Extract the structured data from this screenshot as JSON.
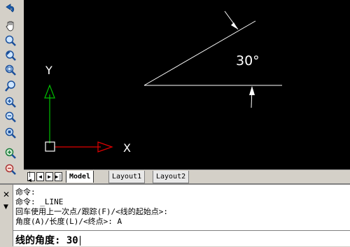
{
  "drawing": {
    "y_axis_label": "Y",
    "x_axis_label": "X",
    "angle_label": "30°"
  },
  "tabs": {
    "items": [
      "Model",
      "Layout1",
      "Layout2"
    ],
    "active": "Model"
  },
  "command": {
    "lines": [
      "命令:",
      "命令: _LINE",
      "回车使用上一次点/跟踪(F)/<线的起始点>:",
      "角度(A)/长度(L)/<终点>: A"
    ],
    "input": "线的角度: 30"
  },
  "icons": {
    "toolbar": [
      "redo-icon",
      "pan-icon",
      "zoom-icon",
      "zoom-previous-icon",
      "zoom-window-icon",
      "zoom-realtime-icon",
      "zoom-in-icon",
      "zoom-out-icon",
      "zoom-extents-icon",
      "zoom-all-icon",
      "zoom-plus-icon",
      "zoom-minus-icon"
    ]
  },
  "colors": {
    "canvas": "#000000",
    "ucs_y": "#00c000",
    "ucs_x": "#e00000"
  }
}
